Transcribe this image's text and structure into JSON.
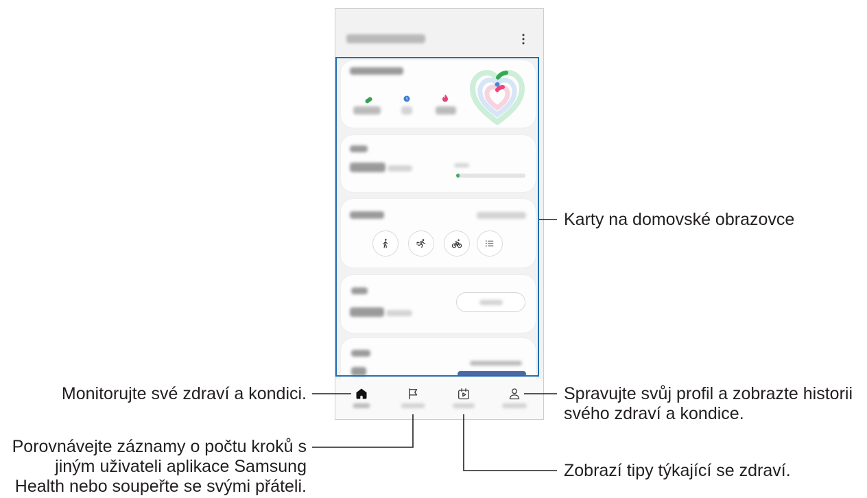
{
  "app": {
    "header": {
      "menu_icon": "more-vertical-icon"
    },
    "activity_card": {
      "icons": [
        "shoe-icon",
        "clock-icon",
        "flame-icon"
      ]
    },
    "steps_card": {
      "progress": 0.05
    },
    "exercise_card": {
      "buttons": [
        "walk-icon",
        "run-icon",
        "bike-icon",
        "list-icon"
      ]
    },
    "nav": [
      {
        "icon": "home-icon",
        "selected": true
      },
      {
        "icon": "flag-icon",
        "selected": false
      },
      {
        "icon": "fitness-icon",
        "selected": false
      },
      {
        "icon": "person-icon",
        "selected": false
      }
    ]
  },
  "callouts": {
    "home_cards": "Karty na domovské obrazovce",
    "home_tab": "Monitorujte své zdraví a kondici.",
    "together_tab": [
      "Porovnávejte záznamy o počtu kroků s",
      "jiným uživateli aplikace Samsung",
      "Health nebo soupeřte se svými přáteli."
    ],
    "my_page_tab": [
      "Spravujte svůj profil a zobrazte historii",
      "svého zdraví a kondice."
    ],
    "fitness_tab": "Zobrazí tipy týkající se zdraví."
  },
  "colors": {
    "highlight_box": "#1e6fb3",
    "leader_lines": "#231f20",
    "steps_progress": "#3fae5f",
    "sleep_bar": "#4a6aa6",
    "heart_arc_outer": "#34a853",
    "heart_arc_middle": "#4285d6",
    "heart_arc_inner": "#e8467c"
  }
}
